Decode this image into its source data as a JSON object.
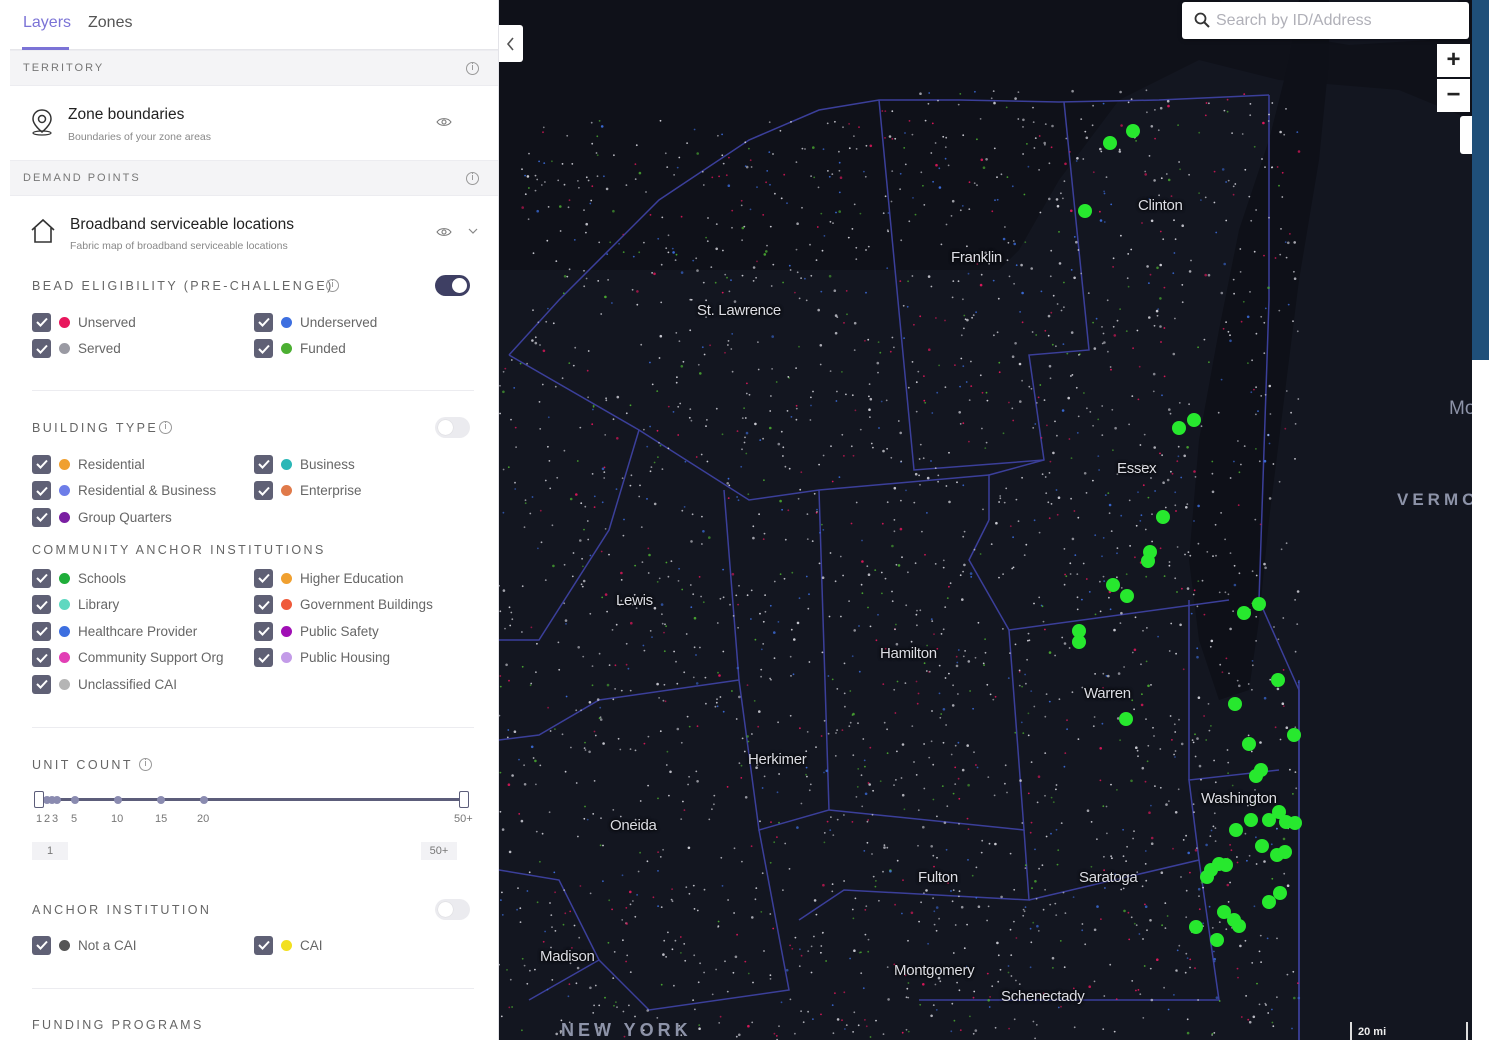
{
  "tabs": [
    "Layers",
    "Zones"
  ],
  "sections": {
    "territory": "TERRITORY",
    "demand_points": "DEMAND POINTS",
    "funding_programs": "FUNDING PROGRAMS"
  },
  "layers": {
    "zone_boundaries": {
      "title": "Zone boundaries",
      "subtitle": "Boundaries of your zone areas"
    },
    "broadband": {
      "title": "Broadband serviceable locations",
      "subtitle": "Fabric map of broadband serviceable locations"
    }
  },
  "bead": {
    "title": "BEAD ELIGIBILITY (PRE-CHALLENGE)",
    "enabled": true,
    "items": [
      {
        "label": "Unserved",
        "color": "#e8175d",
        "checked": true
      },
      {
        "label": "Underserved",
        "color": "#3d6fe0",
        "checked": true
      },
      {
        "label": "Served",
        "color": "#9a9aa3",
        "checked": true
      },
      {
        "label": "Funded",
        "color": "#4caf32",
        "checked": true
      }
    ]
  },
  "building_type": {
    "title": "BUILDING TYPE",
    "enabled": false,
    "items": [
      {
        "label": "Residential",
        "color": "#f0a030",
        "checked": true
      },
      {
        "label": "Business",
        "color": "#2ab7b7",
        "checked": true
      },
      {
        "label": "Residential & Business",
        "color": "#6d7de8",
        "checked": true
      },
      {
        "label": "Enterprise",
        "color": "#e07a4a",
        "checked": true
      },
      {
        "label": "Group Quarters",
        "color": "#7a1fa2",
        "checked": true
      }
    ]
  },
  "cai": {
    "title": "COMMUNITY ANCHOR INSTITUTIONS",
    "items": [
      {
        "label": "Schools",
        "color": "#1fae3a",
        "checked": true
      },
      {
        "label": "Higher Education",
        "color": "#f0a030",
        "checked": true
      },
      {
        "label": "Library",
        "color": "#5ed8c0",
        "checked": true
      },
      {
        "label": "Government Buildings",
        "color": "#ef5a3a",
        "checked": true
      },
      {
        "label": "Healthcare Provider",
        "color": "#3d6fe0",
        "checked": true
      },
      {
        "label": "Public Safety",
        "color": "#a00fb5",
        "checked": true
      },
      {
        "label": "Community Support Org",
        "color": "#e23fb5",
        "checked": true
      },
      {
        "label": "Public Housing",
        "color": "#c39be8",
        "checked": true
      },
      {
        "label": "Unclassified CAI",
        "color": "#b5b5b5",
        "checked": true
      }
    ]
  },
  "unit_count": {
    "title": "UNIT COUNT",
    "ticks": [
      "1",
      "2",
      "3",
      "5",
      "10",
      "15",
      "20",
      "50+"
    ],
    "min_value": "1",
    "max_value": "50+"
  },
  "anchor_institution": {
    "title": "ANCHOR INSTITUTION",
    "enabled": false,
    "items": [
      {
        "label": "Not a CAI",
        "color": "#555555",
        "checked": true
      },
      {
        "label": "CAI",
        "color": "#f2e01f",
        "checked": true
      }
    ]
  },
  "map": {
    "search_placeholder": "Search by ID/Address",
    "zoom_in": "+",
    "zoom_out": "−",
    "scale": "20 mi",
    "region_labels": [
      "NEW YORK",
      "VERMO",
      "Mo"
    ],
    "county_labels": [
      "Clinton",
      "Franklin",
      "St. Lawrence",
      "Essex",
      "Lewis",
      "Hamilton",
      "Warren",
      "Herkimer",
      "Washington",
      "Oneida",
      "Fulton",
      "Saratoga",
      "Madison",
      "Montgomery",
      "Schenectady"
    ]
  }
}
